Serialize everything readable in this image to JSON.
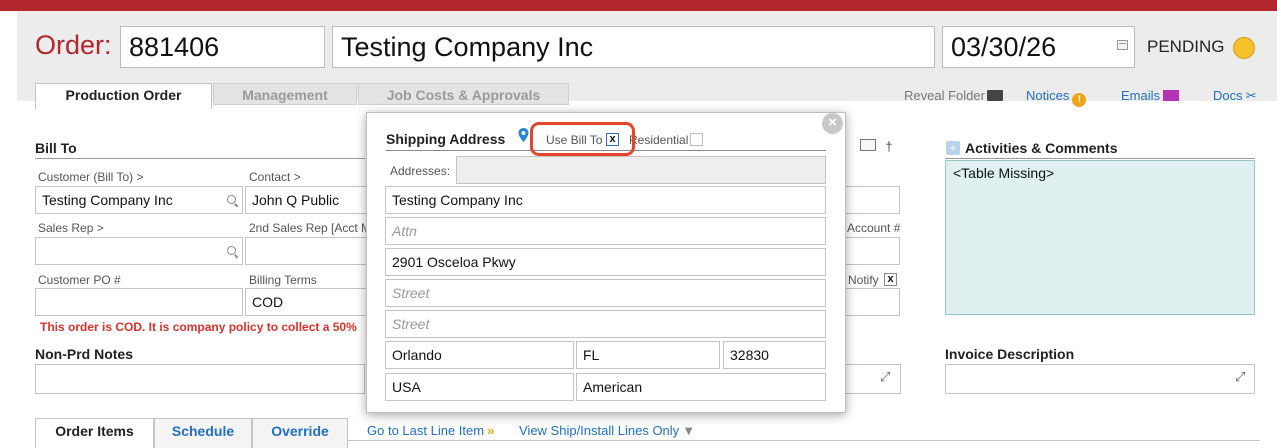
{
  "header": {
    "order_label": "Order:",
    "order_number": "881406",
    "company": "Testing Company Inc",
    "date": "03/30/26",
    "status": "PENDING",
    "status_color": "#f6c12a",
    "brand_color": "#b3262e"
  },
  "tabs": {
    "production_order": "Production Order",
    "management": "Management",
    "job_costs": "Job Costs & Approvals"
  },
  "toolbar": {
    "reveal_folder": "Reveal Folder",
    "notices": "Notices",
    "emails": "Emails",
    "docs": "Docs"
  },
  "bill_to": {
    "title": "Bill To",
    "customer_label": "Customer (Bill To) >",
    "customer_value": "Testing Company Inc",
    "contact_label": "Contact >",
    "contact_value": "John Q Public",
    "sales_rep_label": "Sales Rep >",
    "sales_rep_value": "",
    "second_sales_rep_label": "2nd Sales Rep [Acct M",
    "customer_po_label": "Customer PO #",
    "customer_po_value": "",
    "billing_terms_label": "Billing Terms",
    "billing_terms_value": "COD",
    "account_label": "Account #",
    "notify_label": "Notify",
    "notify_checked": "x",
    "cod_warning": "This order is COD. It is company policy to collect a 50%"
  },
  "notes": {
    "non_prd_title": "Non-Prd Notes",
    "invoice_description_title": "Invoice Description"
  },
  "activities": {
    "title": "Activities & Comments",
    "plus": "+",
    "content": "<Table Missing>"
  },
  "shipping_popup": {
    "title": "Shipping Address",
    "use_bill_to_label": "Use Bill To",
    "use_bill_to_checked": "x",
    "residential_label": "Residential",
    "addresses_label": "Addresses:",
    "company": "Testing Company Inc",
    "attn_placeholder": "Attn",
    "street1": "2901 Osceloa Pkwy",
    "street2_placeholder": "Street",
    "street3_placeholder": "Street",
    "city": "Orlando",
    "state": "FL",
    "zip": "32830",
    "country": "USA",
    "carrier": "American",
    "close": "×"
  },
  "bottom_tabs": {
    "order_items": "Order Items",
    "schedule": "Schedule",
    "override": "Override",
    "go_to_last": "Go to Last Line Item",
    "view_ship": "View Ship/Install Lines Only"
  },
  "icons": [
    "calendar-icon",
    "status-dot-icon",
    "folder-icon",
    "warning-icon",
    "mail-icon",
    "paperclip-icon",
    "search-icon",
    "location-pin-icon",
    "close-icon",
    "expand-icon",
    "plus-icon",
    "chevron-double-down-icon",
    "filter-icon",
    "note-icon",
    "pushpin-icon"
  ]
}
